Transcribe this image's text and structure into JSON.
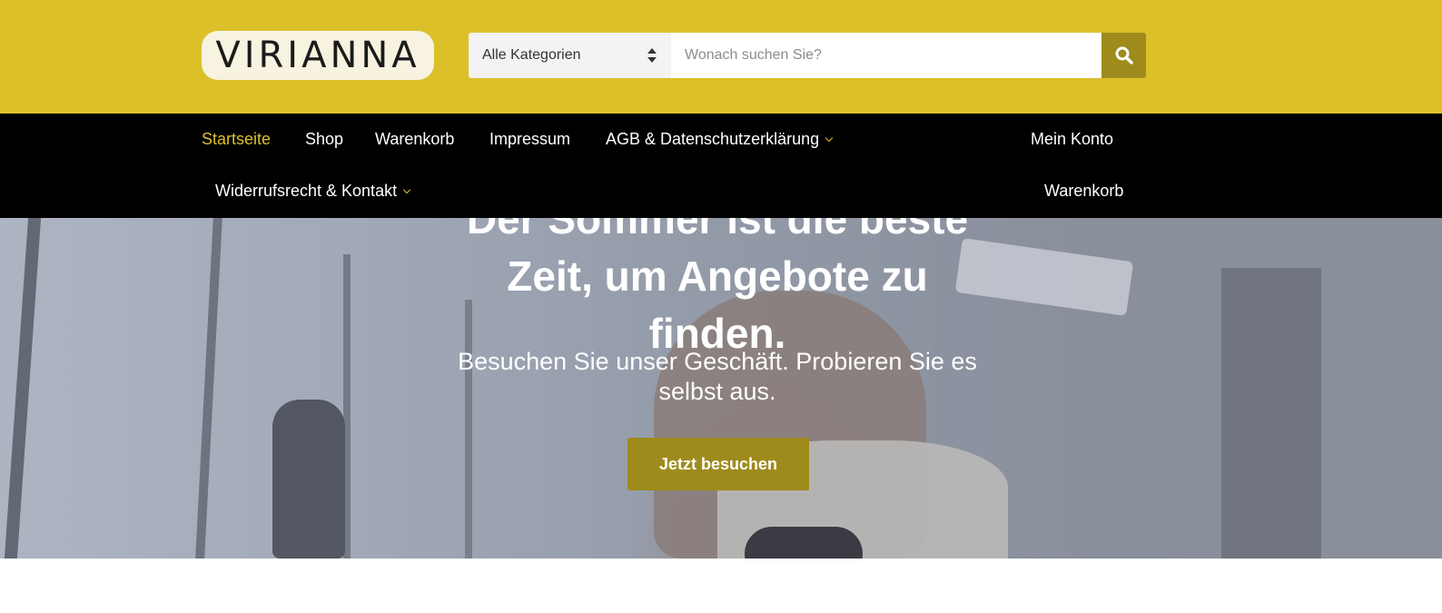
{
  "header": {
    "logo_text": "VIRIANNA",
    "search": {
      "category_value": "Alle Kategorien",
      "placeholder": "Wonach suchen Sie?",
      "button_icon": "search-icon"
    }
  },
  "nav": {
    "primary": [
      {
        "label": "Startseite",
        "active": true
      },
      {
        "label": "Shop"
      },
      {
        "label": "Warenkorb"
      },
      {
        "label": "Impressum"
      },
      {
        "label": "AGB & Datenschutzerklärung",
        "has_submenu": true
      },
      {
        "label": "Widerrufsrecht & Kontakt",
        "has_submenu": true
      }
    ],
    "secondary": [
      {
        "label": "Mein Konto"
      },
      {
        "label": "Warenkorb"
      }
    ]
  },
  "hero": {
    "title": "Der Sommer ist die beste Zeit, um Angebote zu finden.",
    "subtitle": "Besuchen Sie unser Geschäft. Probieren Sie es selbst aus.",
    "cta_label": "Jetzt besuchen"
  },
  "colors": {
    "header_bg": "#dcc02a",
    "accent": "#9e8b1c",
    "nav_bg": "#000000",
    "nav_active": "#dcc02a"
  }
}
